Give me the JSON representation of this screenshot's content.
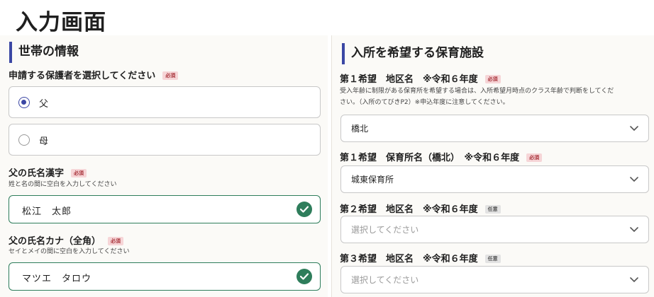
{
  "page_title": "入力画面",
  "left": {
    "section_title": "世帯の情報",
    "guardian_label": "申請する保護者を選択してください",
    "required": "必須",
    "radio_options": [
      "父",
      "母"
    ],
    "kanji_label": "父の氏名漢字",
    "kanji_hint": "姓と名の間に空白を入力してください",
    "kanji_value": "松江　太郎",
    "kana_label": "父の氏名カナ（全角）",
    "kana_hint": "セイとメイの間に空白を入力してください",
    "kana_value": "マツエ　タロウ"
  },
  "right": {
    "section_title": "入所を希望する保育施設",
    "required": "必須",
    "optional": "任意",
    "first_area_label": "第１希望　地区名　※令和６年度",
    "first_area_hint1": "受入年齢に制限がある保育所を希望する場合は、入所希望月時点のクラス年齢で判断をしてくだ",
    "first_area_hint2": "さい。（入所のてびきP2）※申込年度に注意してください。",
    "first_area_value": "橋北",
    "first_school_label": "第１希望　保育所名（橋北）　※令和６年度",
    "first_school_value": "城東保育所",
    "second_area_label": "第２希望　地区名　※令和６年度",
    "second_area_placeholder": "選択してください",
    "third_area_label": "第３希望　地区名　※令和６年度",
    "third_area_placeholder": "選択してください"
  },
  "colors": {
    "accent": "#3b47a4",
    "valid": "#2e7d5b",
    "required_bg": "#f6d5d7"
  }
}
